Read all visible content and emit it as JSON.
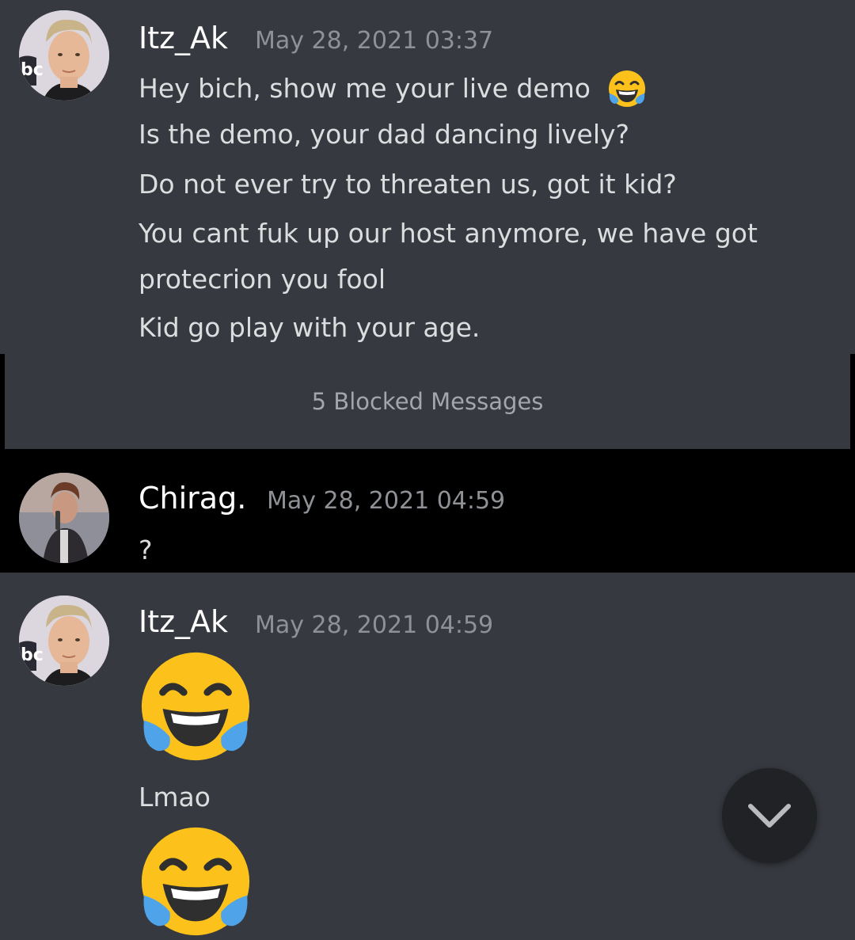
{
  "messages": [
    {
      "author": "Itz_Ak",
      "timestamp": "May 28, 2021 03:37",
      "lines": [
        "Hey bich, show me your live demo",
        "Is the demo, your dad dancing lively?",
        "Do not ever try to threaten us, got it kid?",
        "You cant fuk up our host anymore, we have got",
        "protecrion you fool",
        "Kid go play with your age."
      ]
    },
    {
      "author": "Chirag.",
      "timestamp": "May 28, 2021 04:59",
      "lines": [
        "?"
      ]
    },
    {
      "author": "Itz_Ak",
      "timestamp": "May 28, 2021 04:59",
      "lines": [
        "Lmao"
      ]
    }
  ],
  "blocked": {
    "label": "5 Blocked Messages"
  },
  "icons": {
    "emoji": "face-with-tears-of-joy",
    "scroll": "chevron-down-icon"
  },
  "colors": {
    "background": "#36393f",
    "highlight": "#000000",
    "text": "#dcddde",
    "timestamp": "#8e9297"
  }
}
